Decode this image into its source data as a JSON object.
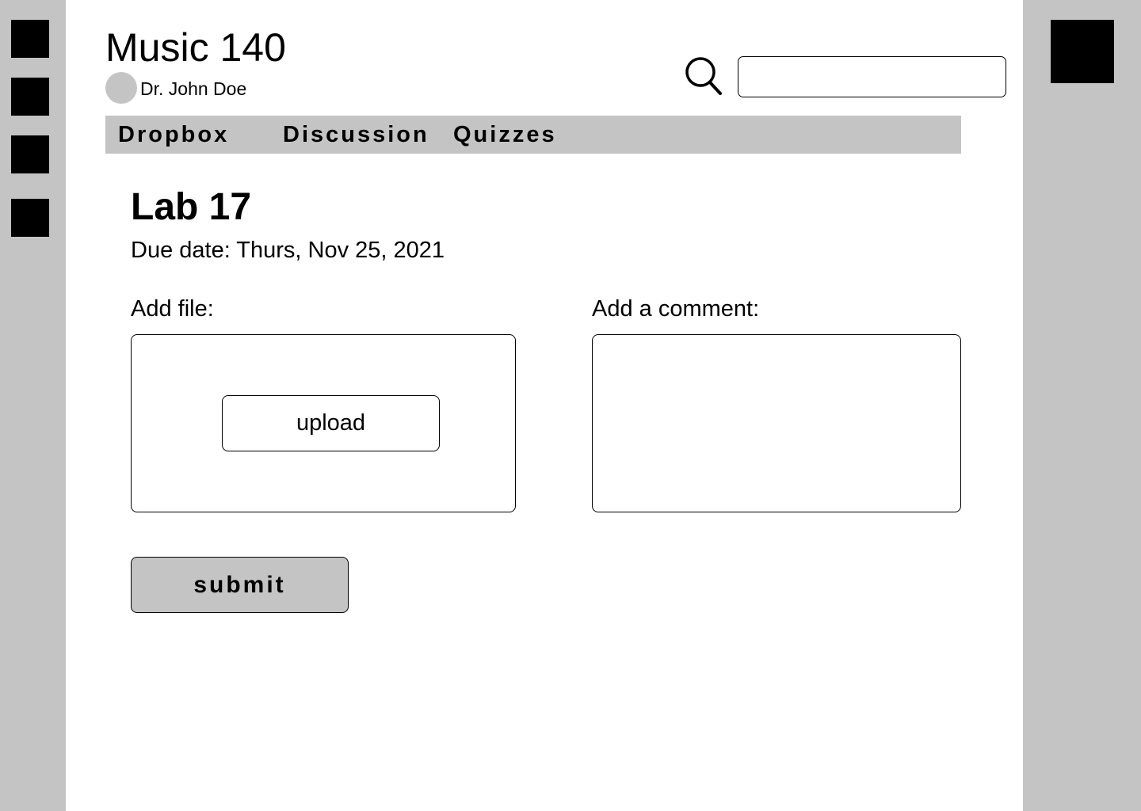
{
  "icons": {
    "left_rail": [
      "square-icon",
      "square-icon",
      "square-icon",
      "square-icon"
    ],
    "right_rail": "square-icon",
    "search": "search-icon",
    "avatar": "avatar-circle"
  },
  "colors": {
    "rail_background": "#c4c4c4",
    "nav_background": "#c4c4c4",
    "submit_background": "#c4c4c4",
    "icon_fill": "#000000"
  },
  "header": {
    "course_title": "Music 140",
    "instructor": "Dr. John Doe"
  },
  "search": {
    "value": "",
    "placeholder": ""
  },
  "nav": {
    "tabs": [
      {
        "label": "Dropbox"
      },
      {
        "label": "Discussion"
      },
      {
        "label": "Quizzes"
      }
    ]
  },
  "assignment": {
    "title": "Lab 17",
    "due_date": "Due date: Thurs, Nov 25, 2021"
  },
  "file_section": {
    "label": "Add file:",
    "upload_label": "upload"
  },
  "comment_section": {
    "label": "Add a comment:",
    "value": ""
  },
  "actions": {
    "submit_label": "submit"
  }
}
